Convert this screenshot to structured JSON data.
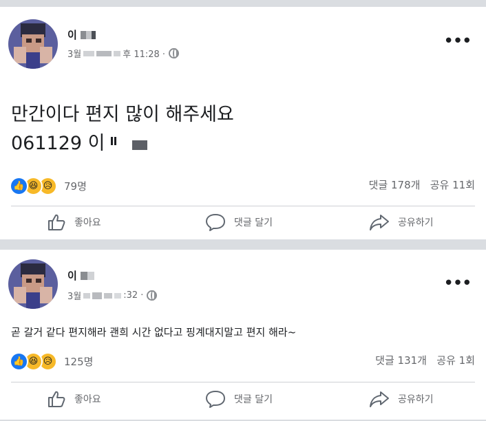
{
  "posts": [
    {
      "author": "이",
      "meta": "3월",
      "time": "후 11:28 ·",
      "body_line1": "만간이다 편지 많이 해주세요",
      "body_line2": "061129 이",
      "reaction_count": "79명",
      "comments": "댓글 178개",
      "shares": "공유 11회",
      "actions": {
        "like": "좋아요",
        "comment": "댓글 달기",
        "share": "공유하기"
      }
    },
    {
      "author": "이",
      "meta": "3월",
      "time": ":32 ·",
      "body": "곧 갈거 같다 편지해라 괜희 시간 없다고 핑계대지말고 편지 해라~",
      "reaction_count": "125명",
      "comments": "댓글 131개",
      "shares": "공유 1회",
      "actions": {
        "like": "좋아요",
        "comment": "댓글 달기",
        "share": "공유하기"
      }
    }
  ],
  "icons": {
    "like": "like-reaction-icon",
    "haha": "haha-reaction-icon",
    "sad": "sad-reaction-icon",
    "more": "more-options-icon",
    "globe": "globe-icon",
    "thumb": "thumbs-up-icon",
    "comment": "comment-icon",
    "share": "share-icon"
  },
  "colors": {
    "accent": "#1877f2",
    "reaction_yellow": "#f7b928",
    "background": "#dadde1",
    "secondary_text": "#65676b"
  }
}
